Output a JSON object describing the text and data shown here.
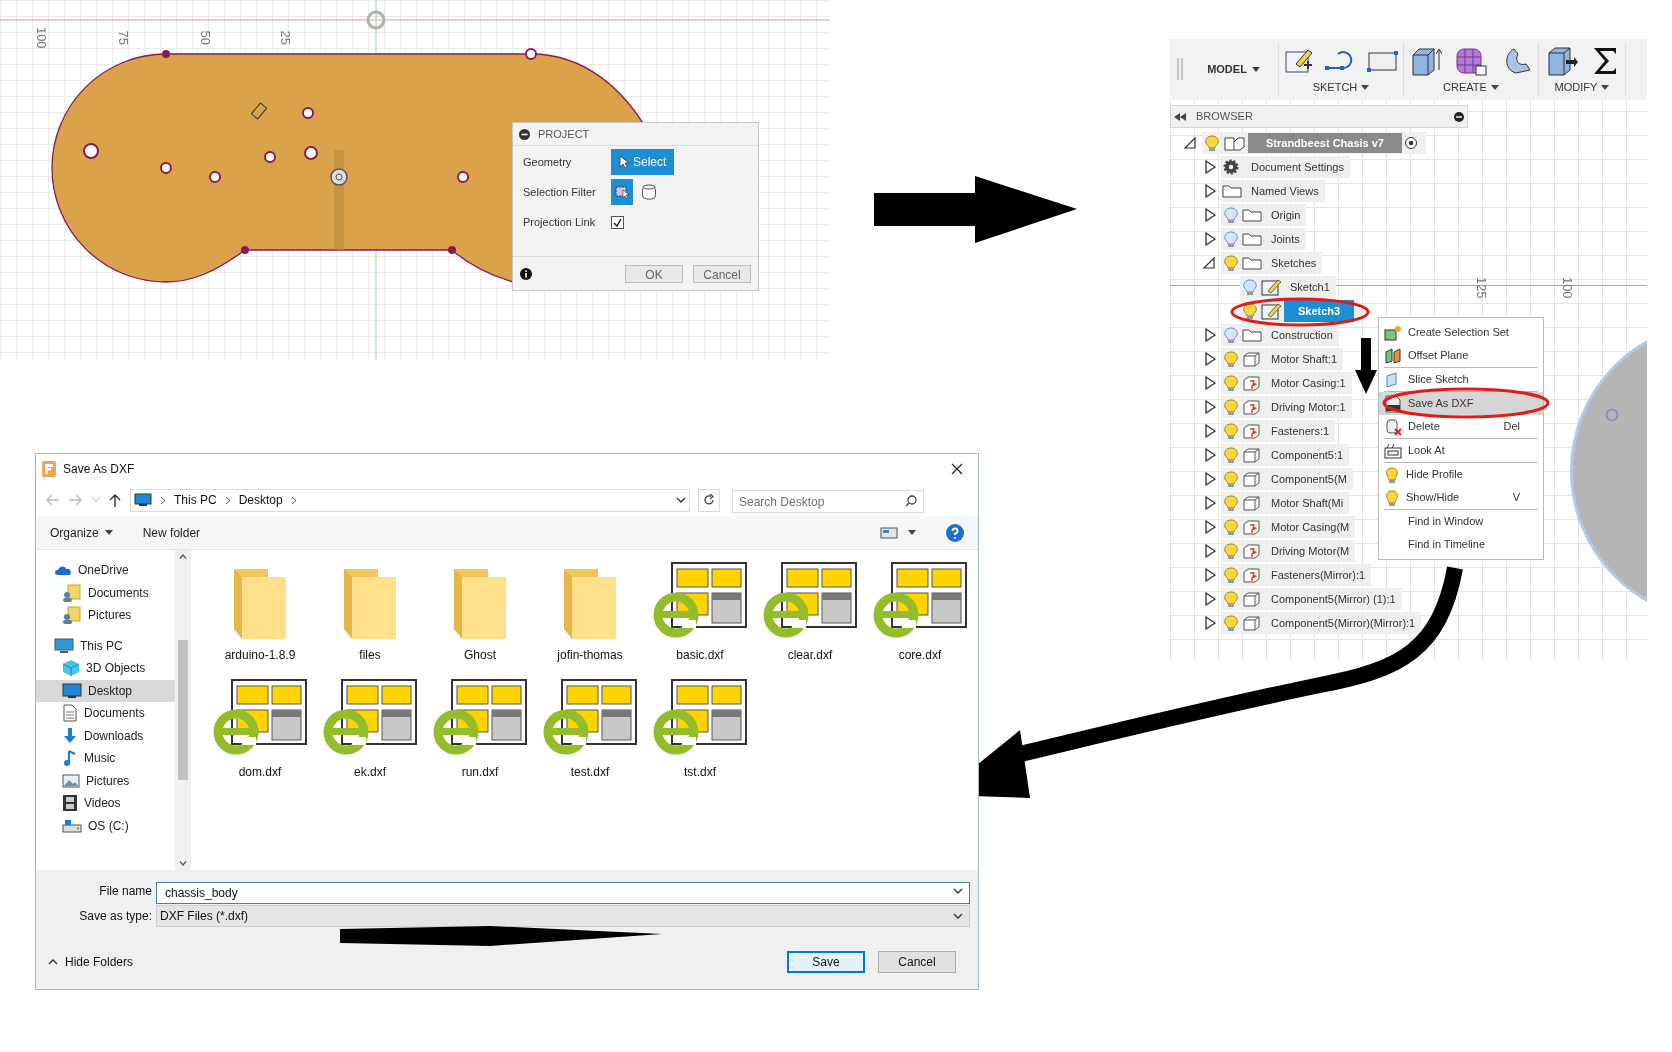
{
  "sketch": {
    "ruler_labels": [
      "100",
      "75",
      "50",
      "25"
    ]
  },
  "project_dialog": {
    "title": "PROJECT",
    "rows": [
      {
        "label": "Geometry",
        "kind": "button",
        "value": "Select"
      },
      {
        "label": "Selection Filter",
        "kind": "filter"
      },
      {
        "label": "Projection Link",
        "kind": "checkbox",
        "checked": true
      }
    ],
    "buttons": [
      "OK",
      "Cancel"
    ]
  },
  "fusion": {
    "workspace": "MODEL",
    "toolbar_groups": [
      "SKETCH",
      "CREATE",
      "MODIFY"
    ],
    "browser_title": "BROWSER",
    "ruler_labels": [
      "125",
      "100"
    ],
    "tree": [
      {
        "label": "Strandbeest Chasis v7",
        "kind": "component",
        "expanded": true,
        "visible": true,
        "active": true,
        "selected": false,
        "children": [
          {
            "label": "Document Settings",
            "kind": "gear",
            "expanded": false,
            "selected": false
          },
          {
            "label": "Named Views",
            "kind": "folder",
            "expanded": false,
            "selected": false
          },
          {
            "label": "Origin",
            "kind": "folder",
            "expanded": false,
            "visible": false,
            "selected": false
          },
          {
            "label": "Joints",
            "kind": "folder",
            "expanded": false,
            "visible": false,
            "selected": false
          },
          {
            "label": "Sketches",
            "kind": "folder",
            "expanded": true,
            "visible": true,
            "selected": false,
            "children": [
              {
                "label": "Sketch1",
                "kind": "sketch",
                "visible": false,
                "selected": false
              },
              {
                "label": "Sketch3",
                "kind": "sketch",
                "visible": true,
                "selected": true
              }
            ]
          },
          {
            "label": "Construction",
            "kind": "folder",
            "expanded": false,
            "visible": false,
            "selected": false
          },
          {
            "label": "Motor Shaft:1",
            "kind": "body",
            "expanded": false,
            "visible": true,
            "selected": false
          },
          {
            "label": "Motor Casing:1",
            "kind": "linked",
            "expanded": false,
            "visible": true,
            "selected": false
          },
          {
            "label": "Driving Motor:1",
            "kind": "linked",
            "expanded": false,
            "visible": true,
            "selected": false
          },
          {
            "label": "Fasteners:1",
            "kind": "linked",
            "expanded": false,
            "visible": true,
            "selected": false
          },
          {
            "label": "Component5:1",
            "kind": "body",
            "expanded": false,
            "visible": true,
            "selected": false
          },
          {
            "label": "Component5(M",
            "kind": "body",
            "expanded": false,
            "visible": true,
            "selected": false
          },
          {
            "label": "Motor Shaft(Mi",
            "kind": "body",
            "expanded": false,
            "visible": true,
            "selected": false
          },
          {
            "label": "Motor Casing(M",
            "kind": "linked",
            "expanded": false,
            "visible": true,
            "selected": false
          },
          {
            "label": "Driving Motor(M",
            "kind": "linked",
            "expanded": false,
            "visible": true,
            "selected": false
          },
          {
            "label": "Fasteners(Mirror):1",
            "kind": "linked",
            "expanded": false,
            "visible": true,
            "selected": false
          },
          {
            "label": "Component5(Mirror) (1):1",
            "kind": "body",
            "expanded": false,
            "visible": true,
            "selected": false
          },
          {
            "label": "Component5(Mirror)(Mirror):1",
            "kind": "body",
            "expanded": false,
            "visible": true,
            "selected": false
          }
        ]
      }
    ],
    "context_menu": [
      {
        "label": "Create Selection Set",
        "kind": "selection-set",
        "selected": false,
        "separator_after": false
      },
      {
        "label": "Offset Plane",
        "kind": "plane",
        "selected": false,
        "separator_after": true
      },
      {
        "label": "Slice Sketch",
        "kind": "slice",
        "selected": false,
        "separator_after": true
      },
      {
        "label": "Save As DXF",
        "kind": "dxf",
        "selected": true,
        "separator_after": false
      },
      {
        "label": "Delete",
        "kind": "delete",
        "shortcut": "Del",
        "selected": false,
        "separator_after": true
      },
      {
        "label": "Look At",
        "kind": "look",
        "selected": false,
        "separator_after": true
      },
      {
        "label": "Hide Profile",
        "kind": "bulb",
        "selected": false,
        "separator_after": false
      },
      {
        "label": "Show/Hide",
        "kind": "bulb",
        "shortcut": "V",
        "selected": false,
        "separator_after": true
      },
      {
        "label": "Find in Window",
        "selected": false,
        "separator_after": false
      },
      {
        "label": "Find in Timeline",
        "selected": false,
        "separator_after": false
      }
    ]
  },
  "save_dialog": {
    "title": "Save As DXF",
    "path": [
      "This PC",
      "Desktop"
    ],
    "search_placeholder": "Search Desktop",
    "toolbar": [
      "Organize",
      "New folder"
    ],
    "nav": [
      {
        "label": "OneDrive",
        "kind": "cloud",
        "selected": false,
        "children": [
          {
            "label": "Documents",
            "kind": "shared",
            "selected": false
          },
          {
            "label": "Pictures",
            "kind": "shared",
            "selected": false
          }
        ]
      },
      {
        "label": "This PC",
        "kind": "pc",
        "selected": false,
        "children": [
          {
            "label": "3D Objects",
            "kind": "cube",
            "selected": false
          },
          {
            "label": "Desktop",
            "kind": "desktop",
            "selected": true
          },
          {
            "label": "Documents",
            "kind": "document",
            "selected": false
          },
          {
            "label": "Downloads",
            "kind": "download",
            "selected": false
          },
          {
            "label": "Music",
            "kind": "music",
            "selected": false
          },
          {
            "label": "Pictures",
            "kind": "picture",
            "selected": false
          },
          {
            "label": "Videos",
            "kind": "video",
            "selected": false
          },
          {
            "label": "OS (C:)",
            "kind": "drive",
            "selected": false
          }
        ]
      }
    ],
    "files": [
      {
        "name": "arduino-1.8.9",
        "kind": "folder"
      },
      {
        "name": "files",
        "kind": "folder"
      },
      {
        "name": "Ghost",
        "kind": "folder"
      },
      {
        "name": "jofin-thomas",
        "kind": "folder"
      },
      {
        "name": "basic.dxf",
        "kind": "dxf"
      },
      {
        "name": "clear.dxf",
        "kind": "dxf"
      },
      {
        "name": "core.dxf",
        "kind": "dxf"
      },
      {
        "name": "dom.dxf",
        "kind": "dxf"
      },
      {
        "name": "ek.dxf",
        "kind": "dxf"
      },
      {
        "name": "run.dxf",
        "kind": "dxf"
      },
      {
        "name": "test.dxf",
        "kind": "dxf"
      },
      {
        "name": "tst.dxf",
        "kind": "dxf"
      }
    ],
    "file_name_label": "File name",
    "file_name": "chassis_body",
    "type_label": "Save as type:",
    "file_type": "DXF Files (*.dxf)",
    "hide_folders": "Hide Folders",
    "buttons": [
      "Save",
      "Cancel"
    ]
  }
}
